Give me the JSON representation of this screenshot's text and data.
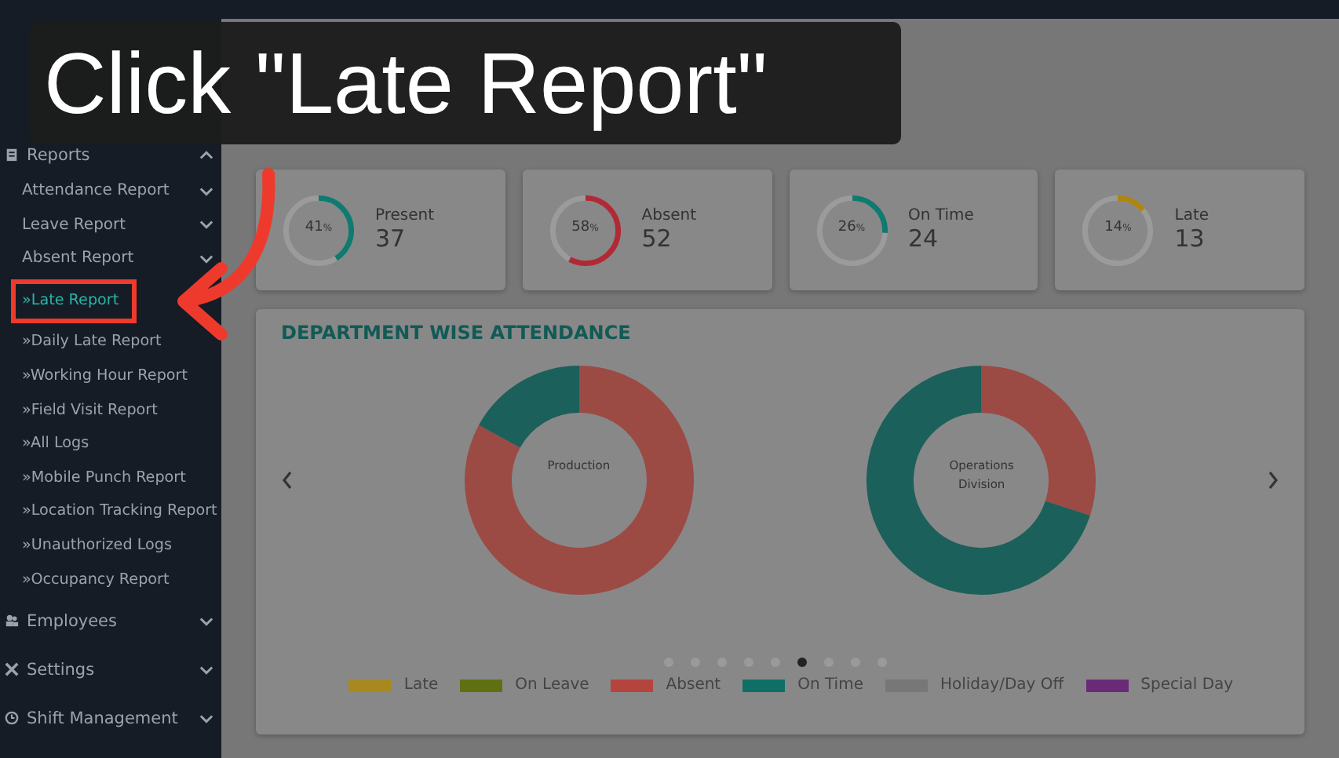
{
  "caption": {
    "text": "Click \"Late Report\""
  },
  "sidebar": {
    "section": {
      "label": "Reports",
      "expanded": true
    },
    "groups": [
      {
        "label": "Attendance Report"
      },
      {
        "label": "Leave Report"
      },
      {
        "label": "Absent Report"
      }
    ],
    "items": [
      {
        "label": "»Late Report",
        "selected": true
      },
      {
        "label": "»Daily Late Report",
        "selected": false
      },
      {
        "label": "»Working Hour Report",
        "selected": false
      },
      {
        "label": "»Field Visit Report",
        "selected": false
      },
      {
        "label": "»All Logs",
        "selected": false
      },
      {
        "label": "»Mobile Punch Report",
        "selected": false
      },
      {
        "label": "»Location Tracking Report",
        "selected": false
      },
      {
        "label": "»Unauthorized Logs",
        "selected": false
      },
      {
        "label": "»Occupancy Report",
        "selected": false
      }
    ],
    "menu": [
      {
        "label": "Employees",
        "kind": "people"
      },
      {
        "label": "Settings",
        "kind": "tools"
      },
      {
        "label": "Shift Management",
        "kind": "clock"
      }
    ]
  },
  "stats": [
    {
      "percent": "41",
      "unit": "%",
      "label": "Present",
      "value": "37",
      "level": 0.41,
      "color": "#0f7a70"
    },
    {
      "percent": "58",
      "unit": "%",
      "label": "Absent",
      "value": "52",
      "level": 0.58,
      "color": "#b02a36"
    },
    {
      "percent": "26",
      "unit": "%",
      "label": "On Time",
      "value": "24",
      "level": 0.26,
      "color": "#0f7a70"
    },
    {
      "percent": "14",
      "unit": "%",
      "label": "Late",
      "value": "13",
      "level": 0.14,
      "color": "#b08410"
    }
  ],
  "department_chart": {
    "title": "DEPARTMENT WISE ATTENDANCE",
    "donuts": [
      {
        "label": "Production"
      },
      {
        "label": "Operations Division"
      }
    ],
    "dots": [
      {
        "selected": false
      },
      {
        "selected": false
      },
      {
        "selected": false
      },
      {
        "selected": false
      },
      {
        "selected": false
      },
      {
        "selected": true
      },
      {
        "selected": false
      },
      {
        "selected": false
      },
      {
        "selected": false
      }
    ],
    "legend": [
      {
        "label": "Late",
        "color": "#a8891f"
      },
      {
        "label": "On Leave",
        "color": "#5e7012"
      },
      {
        "label": "Absent",
        "color": "#b5443f"
      },
      {
        "label": "On Time",
        "color": "#0f6e66"
      },
      {
        "label": "Holiday/Day Off",
        "color": "#777777"
      },
      {
        "label": "Special Day",
        "color": "#6b2a78"
      }
    ]
  }
}
